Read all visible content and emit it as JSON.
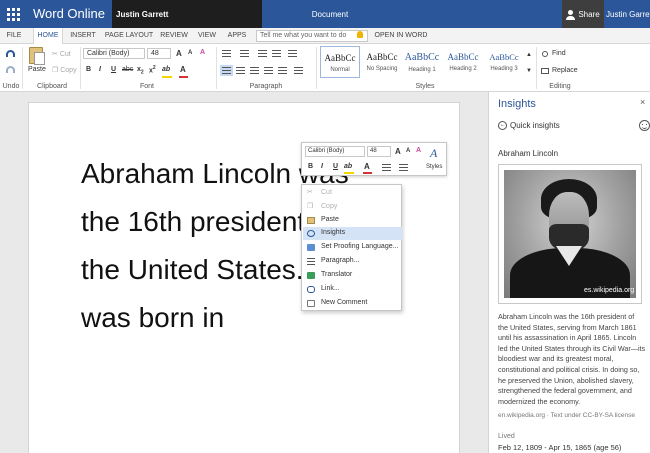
{
  "titlebar": {
    "app_name": "Word Online",
    "user_name": "Justin Garrett",
    "document_title": "Document",
    "share_label": "Share",
    "user_name_right": "Justin Garrett"
  },
  "tabs": [
    {
      "label": "FILE",
      "active": false
    },
    {
      "label": "HOME",
      "active": true
    },
    {
      "label": "INSERT",
      "active": false
    },
    {
      "label": "PAGE LAYOUT",
      "active": false
    },
    {
      "label": "REVIEW",
      "active": false
    },
    {
      "label": "VIEW",
      "active": false
    },
    {
      "label": "APPS",
      "active": false
    }
  ],
  "tell_me": {
    "placeholder": "Tell me what you want to do"
  },
  "open_in_word": "OPEN IN WORD",
  "ribbon": {
    "undo_group": "Undo",
    "clipboard": {
      "group": "Clipboard",
      "paste": "Paste",
      "cut": "Cut",
      "copy": "Copy"
    },
    "font": {
      "group": "Font",
      "family": "Calibri (Body)",
      "size": "48",
      "grow": "A",
      "shrink": "A",
      "clear": "A",
      "bold": "B",
      "italic": "I",
      "underline": "U",
      "strike": "abc",
      "subscript": "x",
      "superscript": "x",
      "highlight": "ab",
      "font_color": "A"
    },
    "paragraph": {
      "group": "Paragraph"
    },
    "styles": {
      "group": "Styles",
      "items": [
        {
          "preview": "AaBbCc",
          "name": "Normal",
          "selected": true
        },
        {
          "preview": "AaBbCc",
          "name": "No Spacing",
          "selected": false
        },
        {
          "preview": "AaBbCc",
          "name": "Heading 1",
          "selected": false
        },
        {
          "preview": "AaBbCc",
          "name": "Heading 2",
          "selected": false
        },
        {
          "preview": "AaBbCc",
          "name": "Heading 3",
          "selected": false
        }
      ]
    },
    "editing": {
      "group": "Editing",
      "find": "Find",
      "replace": "Replace"
    }
  },
  "document": {
    "lines": [
      "Abraham Lincoln was",
      "the 16th president of",
      "the United States. He",
      "was born in"
    ]
  },
  "mini_toolbar": {
    "font_family": "Calibri (Body)",
    "font_size": "48",
    "grow": "A",
    "shrink": "A",
    "clear": "A",
    "bold": "B",
    "italic": "I",
    "underline": "U",
    "highlight": "ab",
    "font_color": "A",
    "styles": "Styles"
  },
  "context_menu": {
    "items": [
      {
        "label": "Cut",
        "enabled": false,
        "highlighted": false,
        "icon": "scissors-icon"
      },
      {
        "label": "Copy",
        "enabled": false,
        "highlighted": false,
        "icon": "copy-icon"
      },
      {
        "label": "Paste",
        "enabled": true,
        "highlighted": false,
        "icon": "paste-icon"
      },
      {
        "label": "Insights",
        "enabled": true,
        "highlighted": true,
        "icon": "insights-icon"
      },
      {
        "label": "Set Proofing Language...",
        "enabled": true,
        "highlighted": false,
        "icon": "proofing-icon"
      },
      {
        "label": "Paragraph...",
        "enabled": true,
        "highlighted": false,
        "icon": "paragraph-icon"
      },
      {
        "label": "Translator",
        "enabled": true,
        "highlighted": false,
        "icon": "translator-icon"
      },
      {
        "label": "Link...",
        "enabled": true,
        "highlighted": false,
        "icon": "link-icon"
      },
      {
        "label": "New Comment",
        "enabled": true,
        "highlighted": false,
        "icon": "comment-icon"
      }
    ]
  },
  "insights": {
    "title": "Insights",
    "close": "×",
    "quick_insights": "Quick insights",
    "topic": "Abraham Lincoln",
    "image_credit": "es.wikipedia.org",
    "bio": "Abraham Lincoln was the 16th president of the United States, serving from March 1861 until his assassination in April 1865. Lincoln led the United States through its Civil War—its bloodiest war and its greatest moral, constitutional and political crisis. In doing so, he preserved the Union, abolished slavery, strengthened the federal government, and modernized the economy.",
    "source": "en.wikipedia.org · Text under CC-BY-SA license",
    "lived_label": "Lived",
    "lived_value": "Feb 12, 1809 - Apr 15, 1865 (age 56)"
  },
  "colors": {
    "accent": "#2b579a",
    "highlight_yellow": "#f2d600",
    "font_red": "#d13438",
    "menu_highlight": "#d4e3f6"
  }
}
